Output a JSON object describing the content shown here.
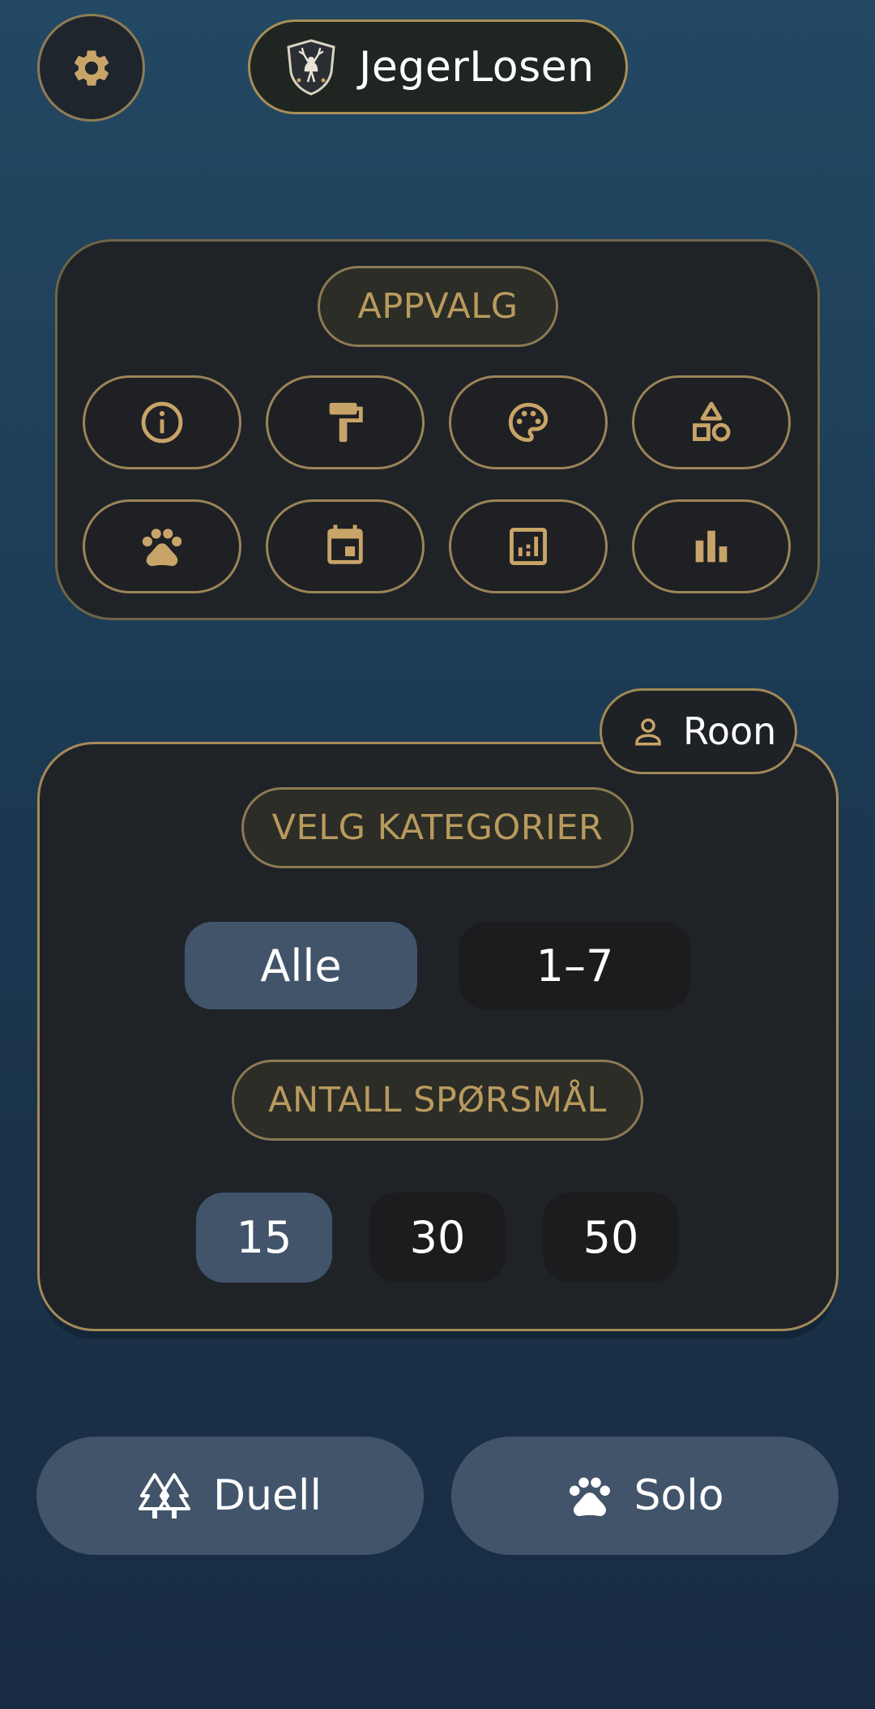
{
  "colors": {
    "accent_gold": "#c9a468",
    "card_bg": "#1f2328",
    "selected_bg": "#42546a",
    "unselected_bg": "#1c1c1e"
  },
  "header": {
    "settings_icon": "gear-icon",
    "app_title": "JegerLosen",
    "logo": "deer-shield-logo"
  },
  "app_options": {
    "heading": "APPVALG",
    "buttons": [
      {
        "icon": "info-icon"
      },
      {
        "icon": "paint-roller-icon"
      },
      {
        "icon": "palette-icon"
      },
      {
        "icon": "shapes-icon"
      },
      {
        "icon": "paw-icon"
      },
      {
        "icon": "calendar-icon"
      },
      {
        "icon": "analytics-icon"
      },
      {
        "icon": "bar-chart-icon"
      }
    ]
  },
  "user": {
    "icon": "person-icon",
    "name": "Roon"
  },
  "categories": {
    "heading": "VELG KATEGORIER",
    "options": [
      "Alle",
      "1–7"
    ],
    "selected": "Alle"
  },
  "question_count": {
    "heading": "ANTALL SPØRSMÅL",
    "options": [
      "15",
      "30",
      "50"
    ],
    "selected": "15"
  },
  "actions": {
    "duel_label": "Duell",
    "duel_icon": "trees-icon",
    "solo_label": "Solo",
    "solo_icon": "paw-icon"
  }
}
